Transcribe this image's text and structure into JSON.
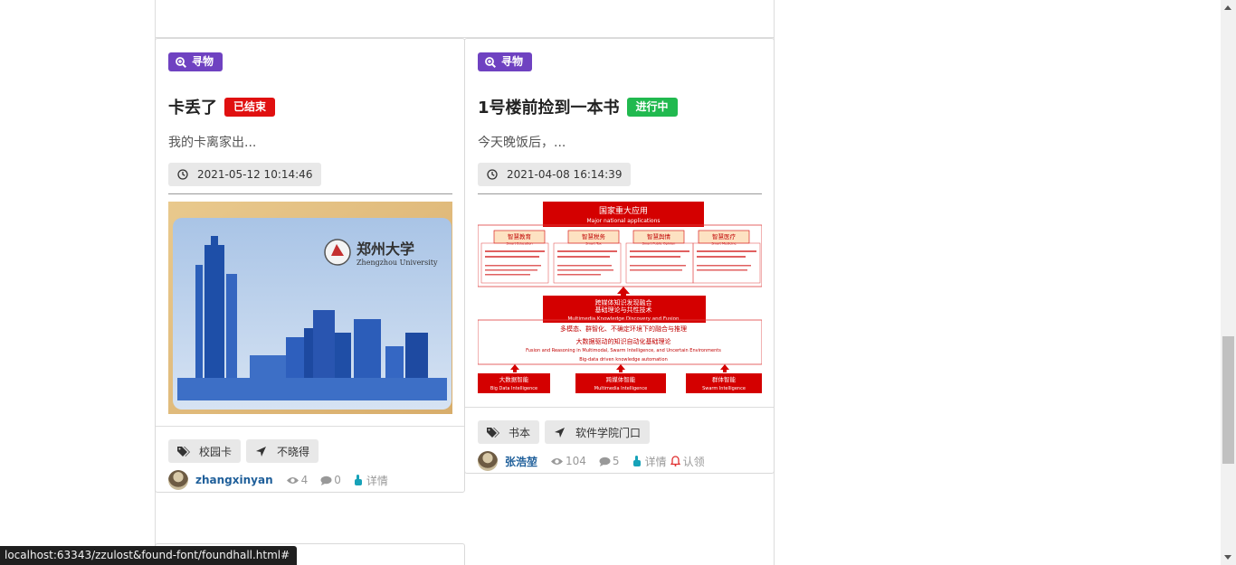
{
  "status_bar": {
    "url": "localhost:63343/zzulost&found-font/foundhall.html#"
  },
  "cards": [
    {
      "type_label": "寻物",
      "title": "卡丢了",
      "status": "已结束",
      "summary": "我的卡离家出...",
      "date": "2021-05-12 10:14:46",
      "image_description": "郑州大学 Zhengzhou University campus card",
      "image_text": {
        "cn": "郑州大学",
        "en": "Zhengzhou University"
      },
      "tags": [
        "校园卡",
        "不晓得"
      ],
      "author": "zhangxinyan",
      "views": "4",
      "comments": "0",
      "detail_label": "详情"
    },
    {
      "type_label": "寻物",
      "title": "1号楼前捡到一本书",
      "status": "进行中",
      "summary": "今天晚饭后，...",
      "date": "2021-04-08 16:14:39",
      "image_text": {
        "top": "国家重大应用",
        "top_en": "Major national applications",
        "boxes": [
          "智慧教育",
          "智慧税务",
          "智慧舆情",
          "智慧医疗"
        ],
        "boxes_en": [
          "Smart Education",
          "Smart Tax",
          "Smart Public Opinion",
          "Smart Medicine"
        ],
        "mid": "跨媒体知识发现融合\n基础理论与共性技术",
        "mid_en": "Multimedia Knowledge Discovery and Fusion",
        "line1": "多模态、群智化、不确定环境下的融合与推理",
        "line2": "大数据驱动的知识自动化基础理论",
        "line2_en": "Fusion and Reasoning in Multimodal, Swarm Intelligence, and Uncertain Environments",
        "line3_en": "Big-data driven knowledge automation",
        "bottom": [
          "大数据智能",
          "跨媒体智能",
          "群体智能"
        ],
        "bottom_en": [
          "Big Data Intelligence",
          "Multimedia Intelligence",
          "Swarm Intelligence"
        ]
      },
      "tags": [
        "书本",
        "软件学院门口"
      ],
      "author": "张浩堃",
      "views": "104",
      "comments": "5",
      "detail_label": "详情",
      "claim_label": "认领"
    }
  ],
  "colors": {
    "type_badge": "#6f42c1",
    "status_done": "#e01010",
    "status_active": "#21b94f",
    "author_link": "#1f5f9a"
  }
}
